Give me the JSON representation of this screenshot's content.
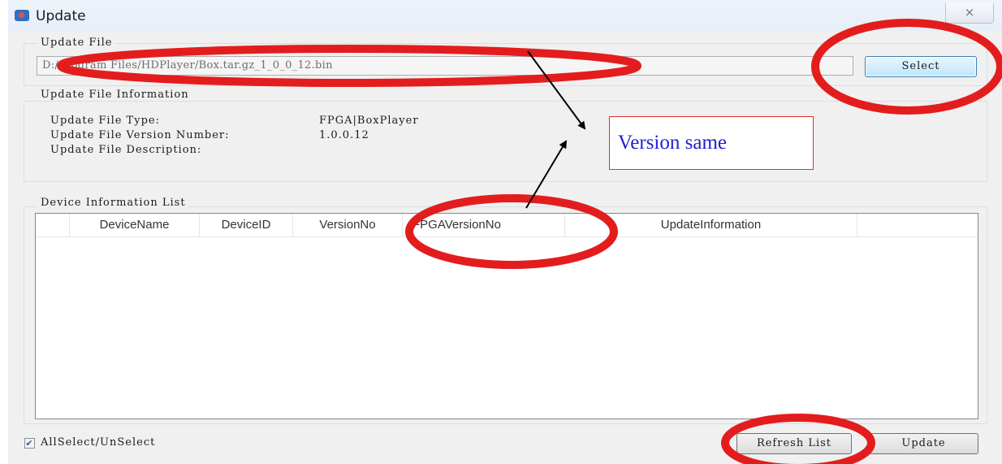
{
  "window": {
    "title": "Update",
    "close_glyph": "⨯"
  },
  "update_file": {
    "legend": "Update File",
    "path": "D:/Program Files/HDPlayer/Box.tar.gz_1_0_0_12.bin",
    "select_label": "Select"
  },
  "file_info": {
    "legend": "Update File Information",
    "rows": [
      {
        "label": "Update File Type:",
        "value": "FPGA|BoxPlayer"
      },
      {
        "label": "Update File Version Number:",
        "value": "1.0.0.12"
      },
      {
        "label": "Update File Description:",
        "value": ""
      }
    ]
  },
  "device_list": {
    "legend": "Device Information List",
    "columns": [
      "DeviceName",
      "DeviceID",
      "VersionNo",
      "FPGAVersionNo",
      "UpdateInformation"
    ],
    "rows": []
  },
  "footer": {
    "allselect_label": "AllSelect/UnSelect",
    "allselect_checked": true,
    "check_glyph": "✔",
    "refresh_label": "Refresh List",
    "update_label": "Update"
  },
  "annotation": {
    "note_text": "Version same",
    "highlight_color": "#e31d1d",
    "note_text_color": "#1f1fd6"
  }
}
